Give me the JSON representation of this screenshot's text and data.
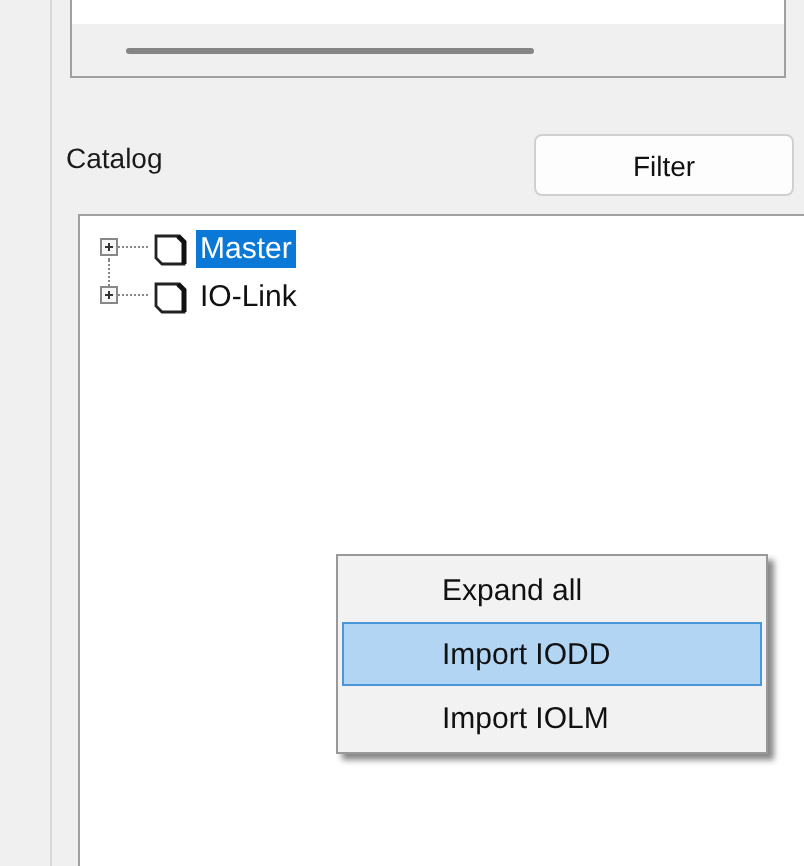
{
  "catalog": {
    "label": "Catalog",
    "filter_button": "Filter"
  },
  "tree": [
    {
      "label": "Master",
      "selected": true,
      "expanded": false
    },
    {
      "label": "IO-Link",
      "selected": false,
      "expanded": false
    }
  ],
  "context_menu": [
    {
      "label": "Expand all",
      "selected": false
    },
    {
      "label": "Import IODD",
      "selected": true
    },
    {
      "label": "Import IOLM",
      "selected": false
    }
  ]
}
